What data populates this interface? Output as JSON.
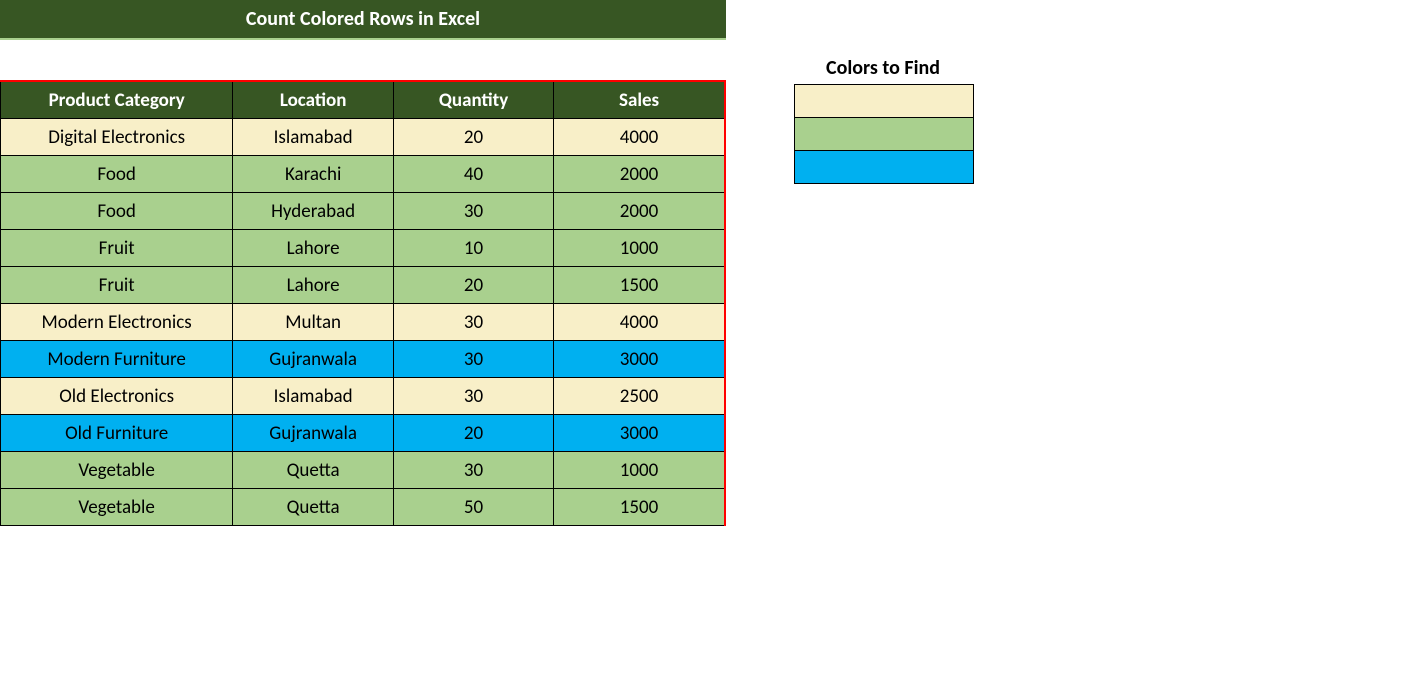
{
  "title": "Count Colored Rows in Excel",
  "headers": [
    "Product Category",
    "Location",
    "Quantity",
    "Sales"
  ],
  "rows": [
    {
      "cat": "Digital Electronics",
      "loc": "Islamabad",
      "qty": "20",
      "sales": "4000",
      "color": "cream"
    },
    {
      "cat": "Food",
      "loc": "Karachi",
      "qty": "40",
      "sales": "2000",
      "color": "green"
    },
    {
      "cat": "Food",
      "loc": "Hyderabad",
      "qty": "30",
      "sales": "2000",
      "color": "green"
    },
    {
      "cat": "Fruit",
      "loc": "Lahore",
      "qty": "10",
      "sales": "1000",
      "color": "green"
    },
    {
      "cat": "Fruit",
      "loc": "Lahore",
      "qty": "20",
      "sales": "1500",
      "color": "green"
    },
    {
      "cat": "Modern Electronics",
      "loc": "Multan",
      "qty": "30",
      "sales": "4000",
      "color": "cream"
    },
    {
      "cat": "Modern Furniture",
      "loc": "Gujranwala",
      "qty": "30",
      "sales": "3000",
      "color": "blue"
    },
    {
      "cat": "Old Electronics",
      "loc": "Islamabad",
      "qty": "30",
      "sales": "2500",
      "color": "cream"
    },
    {
      "cat": "Old Furniture",
      "loc": "Gujranwala",
      "qty": "20",
      "sales": "3000",
      "color": "blue"
    },
    {
      "cat": "Vegetable",
      "loc": "Quetta",
      "qty": "30",
      "sales": "1000",
      "color": "green"
    },
    {
      "cat": "Vegetable",
      "loc": "Quetta",
      "qty": "50",
      "sales": "1500",
      "color": "green"
    }
  ],
  "colors_title": "Colors to Find",
  "colors": [
    "cream",
    "green",
    "blue"
  ],
  "palette": {
    "cream": "#f8efc8",
    "green": "#a9d08e",
    "blue": "#00b0f0"
  }
}
